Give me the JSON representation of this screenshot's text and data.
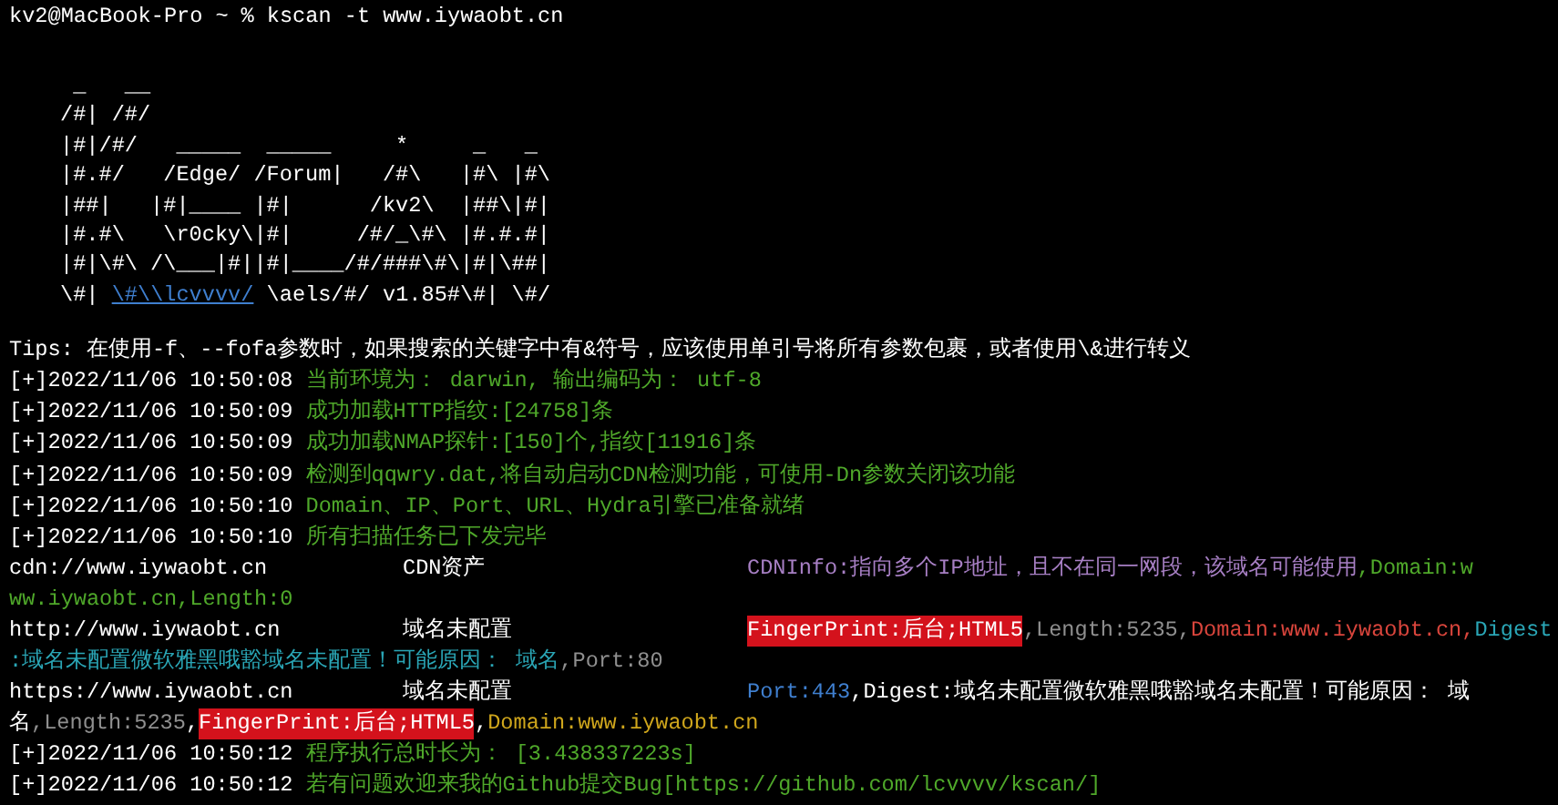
{
  "prompt": {
    "user_host": "kv2@MacBook-Pro",
    "path": "~",
    "symbol": "%",
    "command": "kscan -t www.iywaobt.cn"
  },
  "banner": [
    [
      {
        "text": " _   __",
        "link": false
      }
    ],
    [
      {
        "text": "/#| /#/",
        "link": false
      }
    ],
    [
      {
        "text": "|#|/#/   _____  _____     *     _   _",
        "link": false
      }
    ],
    [
      {
        "text": "|#.#/   /Edge/ /Forum|   /#\\   |#\\ |#\\",
        "link": false
      }
    ],
    [
      {
        "text": "|##|   |#|____ |#|      /kv2\\  |##\\|#|",
        "link": false
      }
    ],
    [
      {
        "text": "|#.#\\   \\r0cky\\|#|     /#/_\\#\\ |#.#.#|",
        "link": false
      }
    ],
    [
      {
        "text": "|#|\\#\\ /\\___|#||#|____/#/###\\#\\|#|\\##|",
        "link": false
      }
    ],
    [
      {
        "text": "\\#| ",
        "link": false
      },
      {
        "text": "\\#\\\\lcvvvv/",
        "link": true
      },
      {
        "text": " \\aels/#/ v1.85#\\#| \\#/",
        "link": false
      }
    ]
  ],
  "output": [
    {
      "kind": "text",
      "segments": [
        {
          "text": "Tips: 在使用-f、--fofa参数时，如果搜索的关键字中有&符号，应该使用单引号将所有参数包裹，或者使用\\&进行转义",
          "color": "#ffffff",
          "highlighted": false
        }
      ]
    },
    {
      "kind": "log",
      "prefix": "[+]2022/11/06 10:50:08",
      "message": "当前环境为： darwin, 输出编码为： utf-8"
    },
    {
      "kind": "log",
      "prefix": "[+]2022/11/06 10:50:09",
      "message": "成功加载HTTP指纹:[24758]条"
    },
    {
      "kind": "log",
      "prefix": "[+]2022/11/06 10:50:09",
      "message": "成功加载NMAP探针:[150]个,指纹[11916]条"
    },
    {
      "kind": "log",
      "prefix": "[+]2022/11/06 10:50:09",
      "message": "检测到qqwry.dat,将自动启动CDN检测功能，可使用-Dn参数关闭该功能"
    },
    {
      "kind": "log",
      "prefix": "[+]2022/11/06 10:50:10",
      "message": "Domain、IP、Port、URL、Hydra引擎已准备就绪"
    },
    {
      "kind": "log",
      "prefix": "[+]2022/11/06 10:50:10",
      "message": "所有扫描任务已下发完毕"
    },
    {
      "kind": "result",
      "url": "cdn://www.iywaobt.cn",
      "title": "CDN资产",
      "segments": [
        {
          "text": "CDNInfo:指向多个IP地址，且不在同一网段，该域名可能使用",
          "color": "#a77fc4",
          "highlighted": false
        },
        {
          "text": ",Domain:w",
          "color": "#4fa82a",
          "highlighted": false
        }
      ]
    },
    {
      "kind": "text",
      "segments": [
        {
          "text": "ww.iywaobt.cn,Length:0",
          "color": "#4fa82a",
          "highlighted": false
        }
      ]
    },
    {
      "kind": "result",
      "url": "http://www.iywaobt.cn",
      "title": "域名未配置",
      "segments": [
        {
          "text": "FingerPrint:后台;HTML5",
          "highlighted": true
        },
        {
          "text": ",Length:5235,",
          "color": "#8f8f8f",
          "highlighted": false
        },
        {
          "text": "Domain:www.iywaobt.cn,",
          "color": "#d9453c",
          "highlighted": false
        },
        {
          "text": "Digest",
          "color": "#2aa6b6",
          "highlighted": false
        }
      ]
    },
    {
      "kind": "text",
      "segments": [
        {
          "text": ":域名未配置微软雅黑哦豁域名未配置！可能原因： 域名",
          "color": "#2aa6b6",
          "highlighted": false
        },
        {
          "text": ",Port:80",
          "color": "#8f8f8f",
          "highlighted": false
        }
      ]
    },
    {
      "kind": "result",
      "url": "https://www.iywaobt.cn",
      "title": "域名未配置",
      "segments": [
        {
          "text": "Port:443",
          "color": "#3f7fcf",
          "highlighted": false
        },
        {
          "text": ",Digest:域名未配置微软雅黑哦豁域名未配置！可能原因： 域",
          "color": "#ffffff",
          "highlighted": false
        }
      ]
    },
    {
      "kind": "text",
      "segments": [
        {
          "text": "名",
          "color": "#ffffff",
          "highlighted": false
        },
        {
          "text": ",Length:5235",
          "color": "#8f8f8f",
          "highlighted": false
        },
        {
          "text": ",",
          "color": "#ffffff",
          "highlighted": false
        },
        {
          "text": "FingerPrint:后台;HTML5",
          "highlighted": true
        },
        {
          "text": ",",
          "color": "#ffffff",
          "highlighted": false
        },
        {
          "text": "Domain:www.iywaobt.cn",
          "color": "#cfa61c",
          "highlighted": false
        }
      ]
    },
    {
      "kind": "log",
      "prefix": "[+]2022/11/06 10:50:12",
      "message": "程序执行总时长为： [3.438337223s]"
    },
    {
      "kind": "log",
      "prefix": "[+]2022/11/06 10:50:12",
      "message": "若有问题欢迎来我的Github提交Bug[https://github.com/lcvvvv/kscan/]"
    }
  ]
}
